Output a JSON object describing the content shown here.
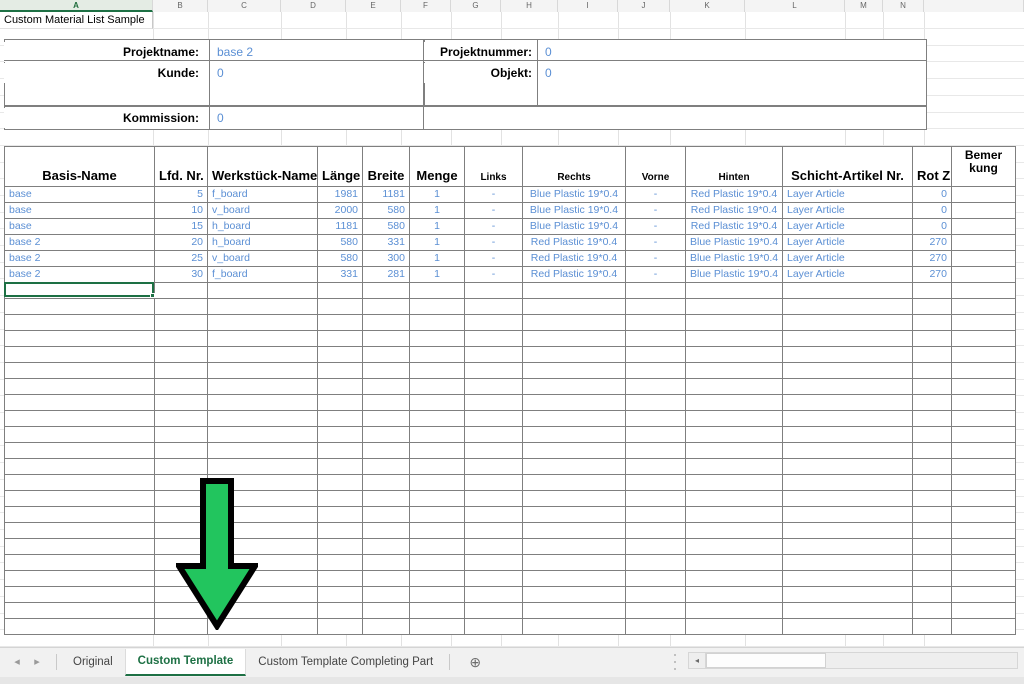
{
  "colheads": [
    "A",
    "B",
    "C",
    "D",
    "E",
    "F",
    "G",
    "H",
    "I",
    "J",
    "K",
    "L",
    "M",
    "N"
  ],
  "active_column": "A",
  "sheet_title": "Custom Material List Sample",
  "info": {
    "projektname_label": "Projektname:",
    "projektname_value": "base 2",
    "projektnummer_label": "Projektnummer:",
    "projektnummer_value": "0",
    "kunde_label": "Kunde:",
    "kunde_value": "0",
    "objekt_label": "Objekt:",
    "objekt_value": "0",
    "kommission_label": "Kommission:",
    "kommission_value": "0"
  },
  "table": {
    "headers": [
      "Basis-Name",
      "Lfd. Nr.",
      "Werkstück-Name",
      "Länge",
      "Breite",
      "Menge",
      "Links",
      "Rechts",
      "Vorne",
      "Hinten",
      "Schicht-Artikel Nr.",
      "Rot Z",
      "Bemer kung"
    ],
    "rows": [
      [
        "base",
        "5",
        "f_board",
        "1981",
        "1181",
        "1",
        "-",
        "Blue Plastic 19*0.4",
        "-",
        "Red Plastic 19*0.4",
        "Layer Article",
        "0",
        ""
      ],
      [
        "base",
        "10",
        "v_board",
        "2000",
        "580",
        "1",
        "-",
        "Blue Plastic 19*0.4",
        "-",
        "Red Plastic 19*0.4",
        "Layer Article",
        "0",
        ""
      ],
      [
        "base",
        "15",
        "h_board",
        "1181",
        "580",
        "1",
        "-",
        "Blue Plastic 19*0.4",
        "-",
        "Red Plastic 19*0.4",
        "Layer Article",
        "0",
        ""
      ],
      [
        "base 2",
        "20",
        "h_board",
        "580",
        "331",
        "1",
        "-",
        "Red Plastic 19*0.4",
        "-",
        "Blue Plastic 19*0.4",
        "Layer Article",
        "270",
        ""
      ],
      [
        "base 2",
        "25",
        "v_board",
        "580",
        "300",
        "1",
        "-",
        "Red Plastic 19*0.4",
        "-",
        "Blue Plastic 19*0.4",
        "Layer Article",
        "270",
        ""
      ],
      [
        "base 2",
        "30",
        "f_board",
        "331",
        "281",
        "1",
        "-",
        "Red Plastic 19*0.4",
        "-",
        "Blue Plastic 19*0.4",
        "Layer Article",
        "270",
        ""
      ]
    ]
  },
  "annotation": {
    "arrow_color": "#22C55E",
    "arrow_outline": "#000000",
    "direction": "down"
  },
  "bottom": {
    "nav_prev": "◂",
    "nav_next": "▸",
    "tabs": [
      {
        "label": "Original",
        "active": false
      },
      {
        "label": "Custom Template",
        "active": true
      },
      {
        "label": "Custom Template Completing Part",
        "active": false
      }
    ],
    "add_sheet": "⊕",
    "scroll_left_arrow": "◂"
  },
  "colors": {
    "value_blue": "#5B8FD4",
    "accent_green": "#1D7044",
    "border_dark": "#7F7F7F",
    "grid_line": "#E2E2E2"
  }
}
